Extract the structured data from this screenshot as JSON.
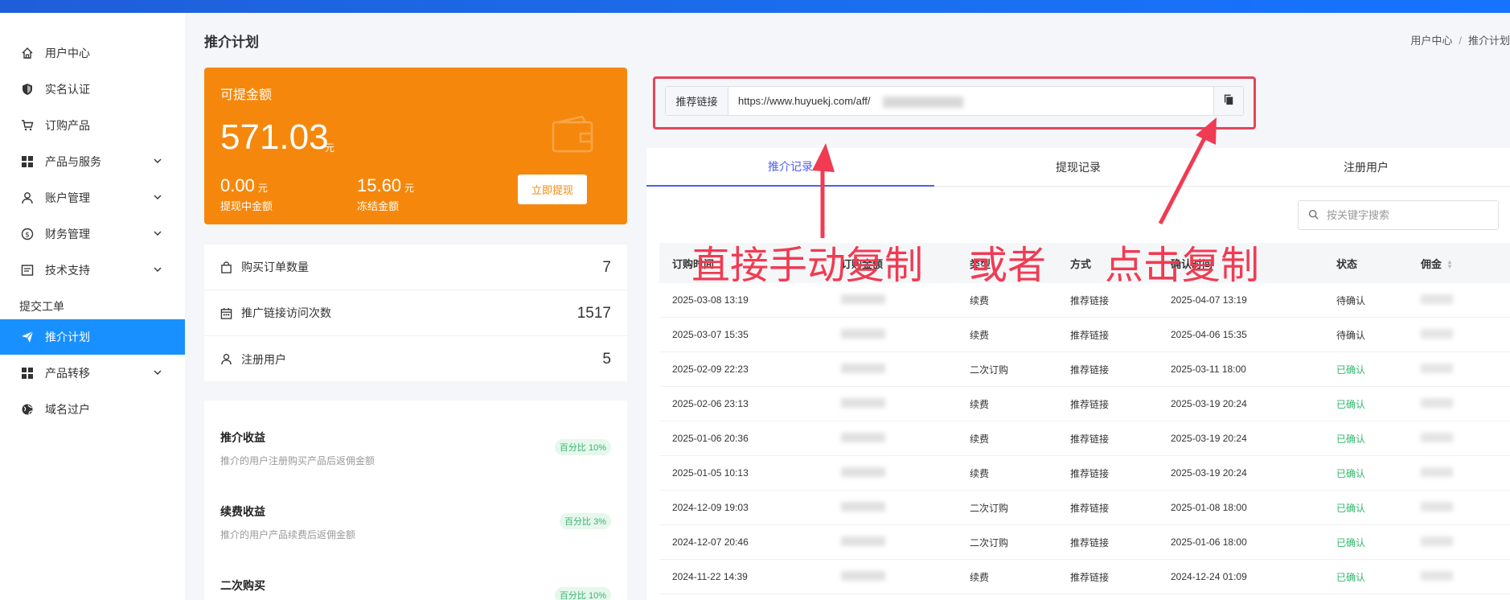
{
  "sidebar": {
    "items": [
      {
        "label": "用户中心",
        "icon": "home-icon",
        "expandable": false
      },
      {
        "label": "实名认证",
        "icon": "shield-icon",
        "expandable": false
      },
      {
        "label": "订购产品",
        "icon": "cart-icon",
        "expandable": false
      },
      {
        "label": "产品与服务",
        "icon": "grid-icon",
        "expandable": true
      },
      {
        "label": "账户管理",
        "icon": "user-icon",
        "expandable": true
      },
      {
        "label": "财务管理",
        "icon": "dollar-icon",
        "expandable": true
      },
      {
        "label": "技术支持",
        "icon": "ticket-icon",
        "expandable": true
      },
      {
        "label": "提交工单",
        "icon": "",
        "expandable": false
      },
      {
        "label": "推介计划",
        "icon": "send-icon",
        "expandable": false,
        "active": true
      },
      {
        "label": "产品转移",
        "icon": "grid-icon",
        "expandable": true
      },
      {
        "label": "域名过户",
        "icon": "globe-icon",
        "expandable": false
      }
    ]
  },
  "header": {
    "title": "推介计划",
    "breadcrumb": [
      "用户中心",
      "推介计划"
    ],
    "breadcrumb_sep": "/"
  },
  "balance": {
    "label": "可提金额",
    "amount": "571.03",
    "unit": "元",
    "pending_value": "0.00",
    "pending_label": "提现中金额",
    "frozen_value": "15.60",
    "frozen_label": "冻结金额",
    "withdraw_label": "立即提现",
    "color": "#f5880c"
  },
  "stats": [
    {
      "label": "购买订单数量",
      "value": "7",
      "icon": "bag-icon"
    },
    {
      "label": "推广链接访问次数",
      "value": "1517",
      "icon": "calendar-icon"
    },
    {
      "label": "注册用户",
      "value": "5",
      "icon": "user-icon"
    }
  ],
  "income": [
    {
      "title": "推介收益",
      "desc": "推介的用户注册购买产品后返佣金额",
      "badge": "百分比 10%"
    },
    {
      "title": "续费收益",
      "desc": "推介的用户产品续费后返佣金额",
      "badge": "百分比 3%"
    },
    {
      "title": "二次购买",
      "desc": "",
      "badge": "百分比 10%"
    }
  ],
  "referral": {
    "label": "推荐链接",
    "value": "https://www.huyuekj.com/aff/"
  },
  "tabs": [
    {
      "label": "推介记录",
      "active": true
    },
    {
      "label": "提现记录",
      "active": false
    },
    {
      "label": "注册用户",
      "active": false
    }
  ],
  "search": {
    "placeholder": "按关键字搜索"
  },
  "table": {
    "columns": [
      "订购时间",
      "订购金额",
      "类型",
      "方式",
      "确认时间",
      "状态",
      "佣金"
    ],
    "rows": [
      {
        "order_time": "2025-03-08 13:19",
        "type": "续费",
        "method": "推荐链接",
        "confirm_time": "2025-04-07 13:19",
        "status": "待确认",
        "ok": false
      },
      {
        "order_time": "2025-03-07 15:35",
        "type": "续费",
        "method": "推荐链接",
        "confirm_time": "2025-04-06 15:35",
        "status": "待确认",
        "ok": false
      },
      {
        "order_time": "2025-02-09 22:23",
        "type": "二次订购",
        "method": "推荐链接",
        "confirm_time": "2025-03-11 18:00",
        "status": "已确认",
        "ok": true
      },
      {
        "order_time": "2025-02-06 23:13",
        "type": "续费",
        "method": "推荐链接",
        "confirm_time": "2025-03-19 20:24",
        "status": "已确认",
        "ok": true
      },
      {
        "order_time": "2025-01-06 20:36",
        "type": "续费",
        "method": "推荐链接",
        "confirm_time": "2025-03-19 20:24",
        "status": "已确认",
        "ok": true
      },
      {
        "order_time": "2025-01-05 10:13",
        "type": "续费",
        "method": "推荐链接",
        "confirm_time": "2025-03-19 20:24",
        "status": "已确认",
        "ok": true
      },
      {
        "order_time": "2024-12-09 19:03",
        "type": "二次订购",
        "method": "推荐链接",
        "confirm_time": "2025-01-08 18:00",
        "status": "已确认",
        "ok": true
      },
      {
        "order_time": "2024-12-07 20:46",
        "type": "二次订购",
        "method": "推荐链接",
        "confirm_time": "2025-01-06 18:00",
        "status": "已确认",
        "ok": true
      },
      {
        "order_time": "2024-11-22 14:39",
        "type": "续费",
        "method": "推荐链接",
        "confirm_time": "2024-12-24 01:09",
        "status": "已确认",
        "ok": true
      }
    ]
  },
  "annotations": {
    "left": "直接手动复制",
    "middle": "或者",
    "right": "点击复制",
    "color": "#f03b52"
  },
  "colors": {
    "accent": "#1890ff",
    "tab_active": "#4c5ef2",
    "status_ok": "#2fb86b"
  }
}
